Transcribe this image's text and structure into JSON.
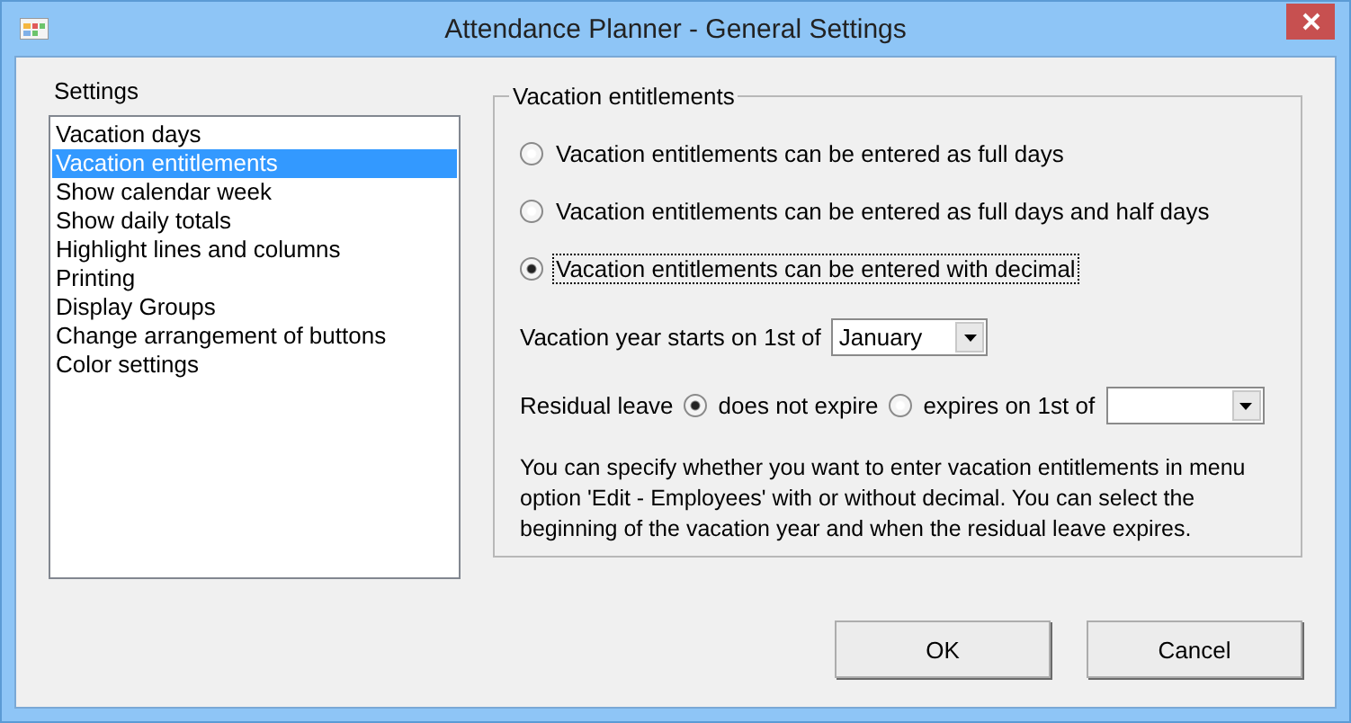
{
  "window": {
    "title": "Attendance Planner - General Settings"
  },
  "settings": {
    "label": "Settings",
    "items": [
      {
        "label": "Vacation days",
        "selected": false
      },
      {
        "label": "Vacation entitlements",
        "selected": true
      },
      {
        "label": "Show calendar week",
        "selected": false
      },
      {
        "label": "Show daily totals",
        "selected": false
      },
      {
        "label": "Highlight lines and columns",
        "selected": false
      },
      {
        "label": "Printing",
        "selected": false
      },
      {
        "label": "Display Groups",
        "selected": false
      },
      {
        "label": "Change arrangement of buttons",
        "selected": false
      },
      {
        "label": "Color settings",
        "selected": false
      }
    ]
  },
  "group": {
    "title": "Vacation entitlements",
    "options": [
      {
        "label": "Vacation entitlements can be entered as full days",
        "selected": false
      },
      {
        "label": "Vacation entitlements can be entered as full days and half days",
        "selected": false
      },
      {
        "label": "Vacation entitlements can be entered with decimal",
        "selected": true
      }
    ],
    "year_start": {
      "label": "Vacation year starts on 1st of",
      "value": "January"
    },
    "residual": {
      "label": "Residual leave",
      "options": [
        {
          "label": "does not expire",
          "selected": true
        },
        {
          "label": "expires on 1st of",
          "selected": false
        }
      ]
    },
    "description": "You can specify whether you want to enter vacation entitlements in menu option 'Edit - Employees' with or without decimal. You can select the beginning of the vacation year and when the residual leave expires."
  },
  "buttons": [
    "OK",
    "Cancel"
  ]
}
